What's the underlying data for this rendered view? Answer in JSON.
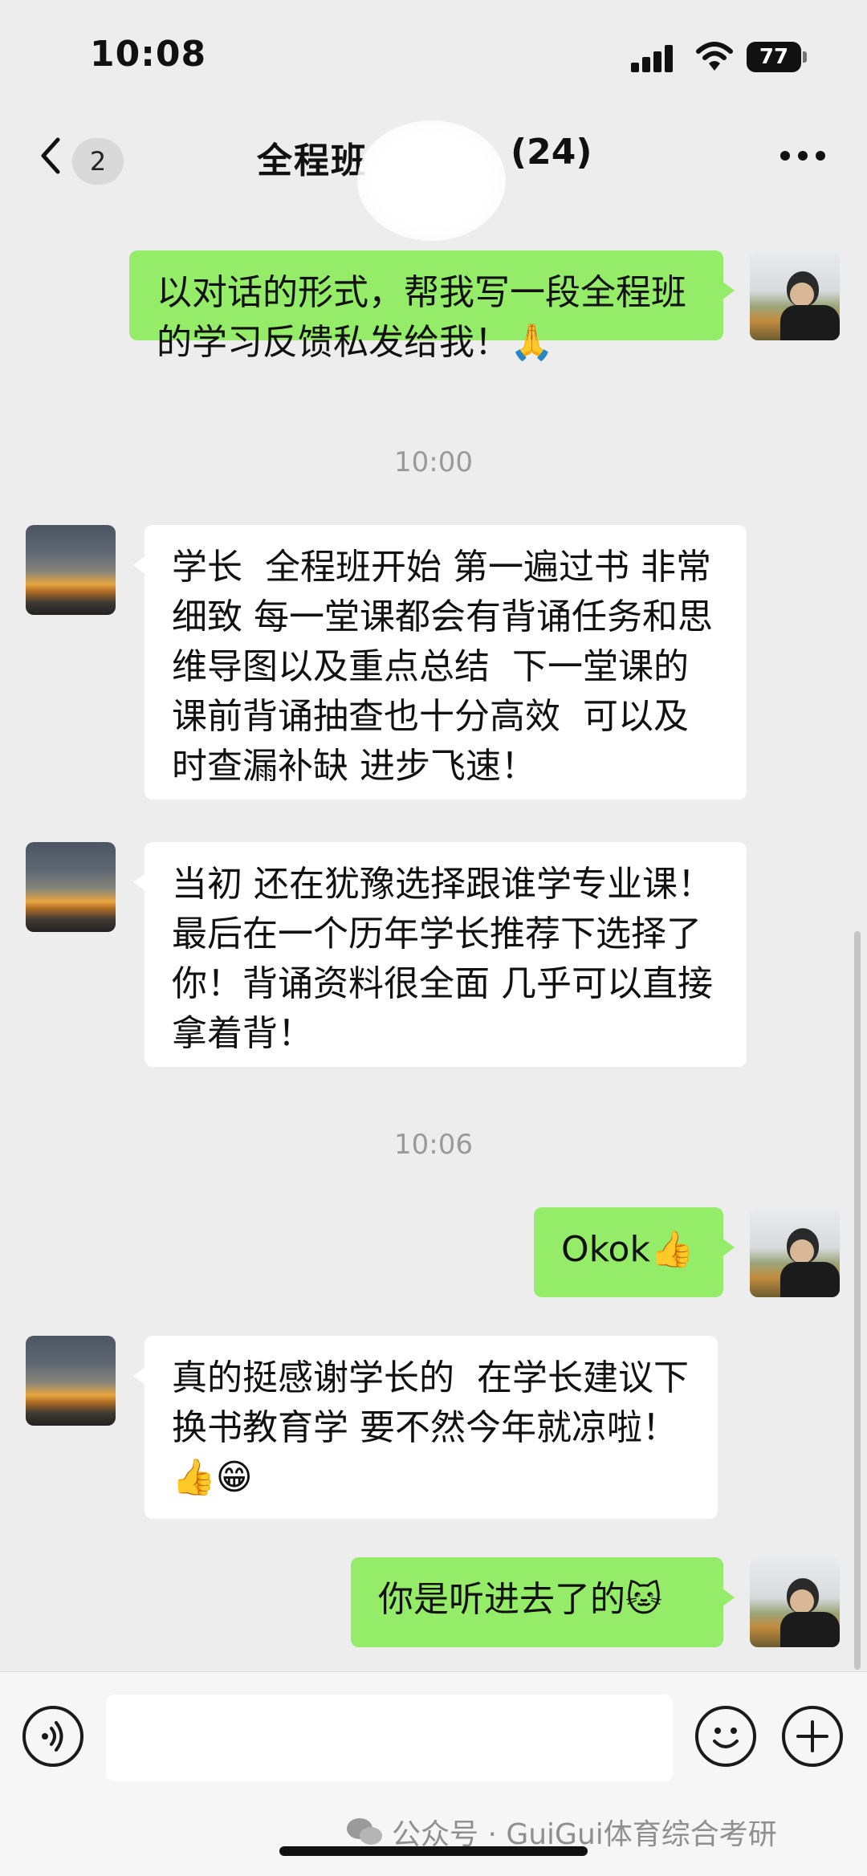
{
  "status_bar": {
    "time": "10:08",
    "battery": "77"
  },
  "nav": {
    "unread_count": "2",
    "title": "全程班",
    "member_count": "(24)"
  },
  "messages": [
    {
      "side": "self",
      "text": "以对话的形式，帮我写一段全程班的学习反馈私发给我！🙏"
    },
    {
      "side": "time",
      "text": "10:00"
    },
    {
      "side": "other",
      "text": "学长  全程班开始 第一遍过书 非常细致 每一堂课都会有背诵任务和思维导图以及重点总结  下一堂课的课前背诵抽查也十分高效  可以及时查漏补缺 进步飞速！"
    },
    {
      "side": "other",
      "text": "当初 还在犹豫选择跟谁学专业课！最后在一个历年学长推荐下选择了你！背诵资料很全面 几乎可以直接拿着背！"
    },
    {
      "side": "time",
      "text": "10:06"
    },
    {
      "side": "self",
      "text": "Okok👍"
    },
    {
      "side": "other",
      "text": "真的挺感谢学长的  在学长建议下 换书教育学 要不然今年就凉啦！👍😁"
    },
    {
      "side": "self",
      "text": "你是听进去了的🐱"
    }
  ],
  "input": {
    "placeholder": ""
  },
  "watermark": "公众号 · GuiGui体育综合考研",
  "colors": {
    "self_bubble": "#95ec69",
    "other_bubble": "#ffffff",
    "background": "#ededed"
  },
  "icons": {
    "back": "chevron-left-icon",
    "more": "more-dots-icon",
    "voice": "voice-icon",
    "emoji": "emoji-icon",
    "plus": "plus-icon",
    "signal": "signal-icon",
    "wifi": "wifi-icon",
    "battery": "battery-icon"
  }
}
